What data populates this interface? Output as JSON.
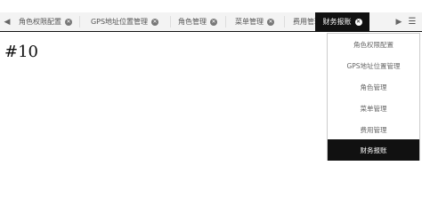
{
  "tabbar": {
    "left_arrow_icon": "caret-left-icon",
    "right_arrow_icon": "caret-right-icon",
    "menu_icon": "list-menu-icon",
    "close_icon": "circle-x-icon",
    "tabs": [
      {
        "label": "角色权限配置",
        "active": false
      },
      {
        "label": "GPS地址位置管理",
        "active": false
      },
      {
        "label": "角色管理",
        "active": false
      },
      {
        "label": "菜单管理",
        "active": false
      },
      {
        "label": "费用管理",
        "active": false
      },
      {
        "label": "财务报账",
        "active": true
      }
    ]
  },
  "content": {
    "id_text": "#10"
  },
  "dropdown": {
    "items": [
      {
        "label": "角色权限配置",
        "active": false
      },
      {
        "label": "GPS地址位置管理",
        "active": false
      },
      {
        "label": "角色管理",
        "active": false
      },
      {
        "label": "菜单管理",
        "active": false
      },
      {
        "label": "费用管理",
        "active": false
      },
      {
        "label": "财务报账",
        "active": true
      }
    ]
  },
  "colors": {
    "active_bg": "#111111",
    "tabbar_bg": "#f3f3f3"
  }
}
